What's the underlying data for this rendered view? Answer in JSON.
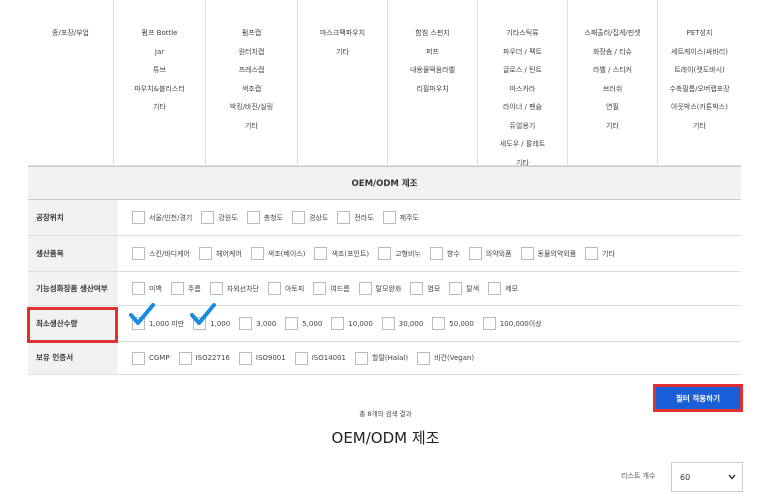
{
  "categories": {
    "columns": [
      {
        "items": [
          "종/포장/부업"
        ]
      },
      {
        "items": [
          "펌프 Bottle",
          "Jar",
          "튜브",
          "파우치&블리스터",
          "기타"
        ]
      },
      {
        "items": [
          "펌프캡",
          "원터치캡",
          "프레스캡",
          "색조캡",
          "박킹/바진/실링",
          "기타"
        ]
      },
      {
        "items": [
          "마스크팩파우치",
          "기타"
        ]
      },
      {
        "items": [
          "함침 스펀지",
          "퍼프",
          "내용물떡음라벨",
          "리필파우치"
        ]
      },
      {
        "items": [
          "기타스틱류",
          "파우더 / 팩트",
          "글로스 / 틴트",
          "마스카라",
          "라이너 / 펜슬",
          "듀얼용기",
          "세도우 / 팔레트",
          "기타"
        ]
      },
      {
        "items": [
          "스패출러/집게/핀셋",
          "화장솜 / 티슈",
          "라벨 / 스티커",
          "브러쉬",
          "연필",
          "기타"
        ]
      },
      {
        "items": [
          "PET성지",
          "세트케이스(싸바리)",
          "트레이(캣도바시)",
          "수축필름/오버랩포장",
          "아웃박스(카톤박스)",
          "기타"
        ]
      }
    ]
  },
  "section_title": "OEM/ODM 제조",
  "filters": [
    {
      "label": "공장위치",
      "options": [
        "서울/인천/경기",
        "강원도",
        "충청도",
        "경상도",
        "전라도",
        "제주도"
      ],
      "checked": []
    },
    {
      "label": "생산품목",
      "options": [
        "스킨/바디케어",
        "헤어케어",
        "색조(베이스)",
        "색조(포인트)",
        "고형비누",
        "향수",
        "의약외품",
        "동물의약외품",
        "기타"
      ],
      "checked": []
    },
    {
      "label": "기능성화장품 생산여부",
      "options": [
        "미백",
        "주름",
        "자외선차단",
        "아토피",
        "여드름",
        "탈모완화",
        "염모",
        "탈색",
        "제모"
      ],
      "checked": []
    },
    {
      "label": "최소생산수량",
      "options": [
        "1,000 미만",
        "1,000",
        "3,000",
        "5,000",
        "10,000",
        "30,000",
        "50,000",
        "100,000이상"
      ],
      "checked": [
        0,
        1
      ]
    },
    {
      "label": "보유 인증서",
      "options": [
        "CGMP",
        "ISO22716",
        "ISO9001",
        "ISO14001",
        "할랄(Halal)",
        "비건(Vegan)"
      ],
      "checked": []
    }
  ],
  "apply_button": "필터 적용하기",
  "result_count": "총 8개의 검색 결과",
  "result_title": "OEM/ODM 제조",
  "list_count": {
    "label": "리스트 개수",
    "value": "60"
  },
  "colors": {
    "highlight": "#e03030",
    "check": "#1a8ce0",
    "button": "#1a5ed8"
  }
}
